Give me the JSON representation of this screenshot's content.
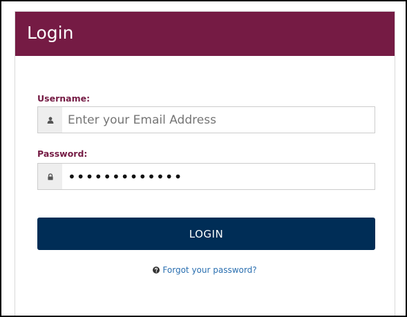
{
  "header": {
    "title": "Login"
  },
  "form": {
    "username": {
      "label": "Username:",
      "placeholder": "Enter your Email Address",
      "value": "",
      "icon": "user-icon"
    },
    "password": {
      "label": "Password:",
      "value": "•••••••••••••",
      "icon": "lock-icon"
    },
    "submit_label": "LOGIN",
    "forgot_label": "Forgot your password?",
    "forgot_icon": "question-circle-icon"
  },
  "colors": {
    "header_bg": "#751b44",
    "label": "#751b44",
    "button_bg": "#002d56",
    "link": "#2a6fb0",
    "addon_bg": "#eeeeee"
  }
}
